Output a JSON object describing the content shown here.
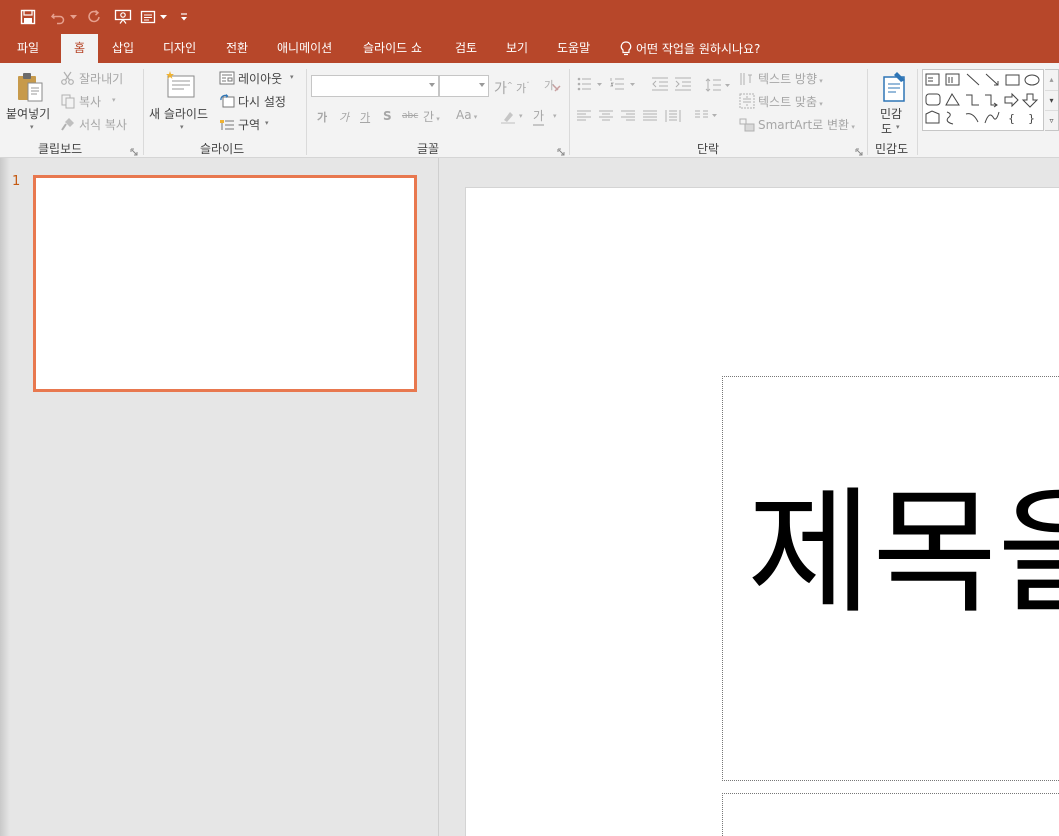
{
  "quick_access": {
    "save_icon": "save-icon",
    "undo_icon": "undo-icon",
    "redo_icon": "redo-icon",
    "present_icon": "slideshow-from-start-icon",
    "layout_icon": "touch-mode-icon",
    "customize_icon": "customize-qat-icon"
  },
  "tabs": [
    "파일",
    "홈",
    "삽입",
    "디자인",
    "전환",
    "애니메이션",
    "슬라이드 쇼",
    "검토",
    "보기",
    "도움말"
  ],
  "active_tab": "홈",
  "tell_me": "어떤 작업을 원하시나요?",
  "ribbon": {
    "clipboard": {
      "label": "클립보드",
      "paste": "붙여넣기",
      "cut": "잘라내기",
      "copy": "복사",
      "format_painter": "서식 복사"
    },
    "slides": {
      "label": "슬라이드",
      "new_slide_line1": "새 슬라이드",
      "layout": "레이아웃",
      "reset": "다시 설정",
      "section": "구역"
    },
    "font": {
      "label": "글꼴",
      "font_name": "",
      "font_size": "",
      "grow_icon": "가",
      "shrink_icon": "가",
      "bold": "가",
      "italic": "가",
      "underline": "가",
      "shadow": "S",
      "strike": "abc",
      "spacing": "간",
      "case": "Aa",
      "font_color": "가"
    },
    "paragraph": {
      "label": "단락",
      "text_direction": "텍스트 방향",
      "align_text": "텍스트 맞춤",
      "smartart": "SmartArt로 변환"
    },
    "sensitivity": {
      "label": "민감도",
      "button_line1": "민감",
      "button_line2": "도"
    }
  },
  "thumbnails": [
    {
      "number": "1"
    }
  ],
  "slide": {
    "title_placeholder": "제목을"
  },
  "colors": {
    "accent": "#b7472a",
    "thumb_border": "#e8784f"
  }
}
